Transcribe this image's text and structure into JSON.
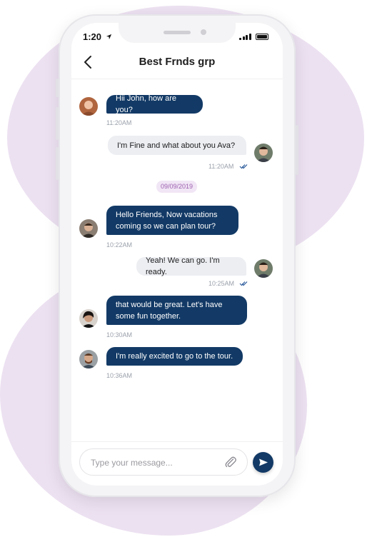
{
  "status": {
    "time": "1:20"
  },
  "header": {
    "title": "Best Frnds grp"
  },
  "messages": [
    {
      "text": "Hii John, how are you?",
      "time": "11:20AM",
      "direction": "in"
    },
    {
      "text": "I'm Fine and what about you Ava?",
      "time": "11:20AM",
      "direction": "out",
      "read": true
    },
    {
      "text": "Hello Friends, Now vacations coming so we can plan tour?",
      "time": "10:22AM",
      "direction": "in"
    },
    {
      "text": "Yeah! We can go. I'm ready.",
      "time": "10:25AM",
      "direction": "out",
      "read": true
    },
    {
      "text": "that would be great. Let's have some fun together.",
      "time": "10:30AM",
      "direction": "in"
    },
    {
      "text": "I'm really excited to go to the tour.",
      "time": "10:36AM",
      "direction": "in"
    }
  ],
  "date_separator": "09/09/2019",
  "composer": {
    "placeholder": "Type your message..."
  },
  "colors": {
    "incoming_bubble": "#133a66",
    "outgoing_bubble": "#eceef2",
    "date_pill": "#f1e6f5",
    "background_blob": "#ece1f1"
  },
  "icons": [
    "back-arrow-icon",
    "signal-icon",
    "battery-icon",
    "paperclip-icon",
    "send-icon",
    "read-ticks-icon"
  ]
}
